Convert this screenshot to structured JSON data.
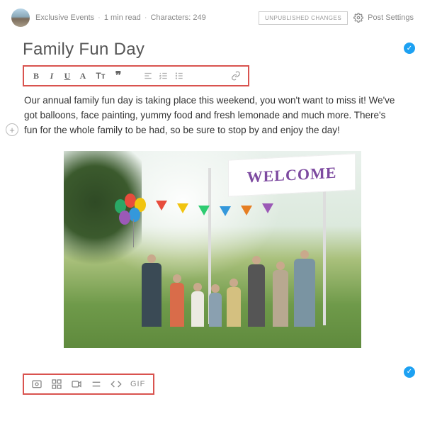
{
  "header": {
    "author": "Exclusive Events",
    "read_time": "1 min read",
    "char_label": "Characters: 249",
    "unpublished_label": "UNPUBLISHED CHANGES",
    "settings_label": "Post Settings"
  },
  "post": {
    "title": "Family Fun Day",
    "body": "Our annual family fun day is taking place this weekend, you won't want to miss it! We've got balloons, face painting, yummy food and fresh lemonade and much more. There's fun for the   whole family to be had, so be sure to stop by and enjoy the day!",
    "banner_text": "WELCOME"
  },
  "toolbar": {
    "bold": "B",
    "italic": "I",
    "underline": "U",
    "textcolor": "A",
    "textsize": "Tт",
    "quote": "❞"
  },
  "media": {
    "gif_label": "GIF"
  }
}
